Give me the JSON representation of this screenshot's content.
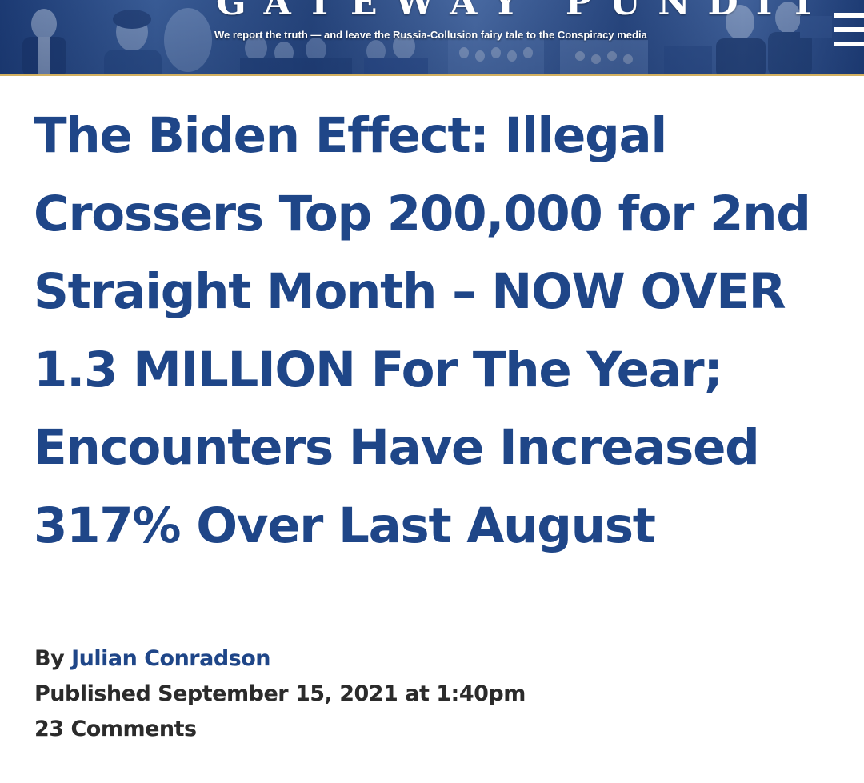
{
  "header": {
    "site_name": "GATEWAY PUNDIT",
    "tagline": "We report the truth — and leave the Russia-Collusion fairy tale to the Conspiracy media",
    "menu_icon": "hamburger-menu-icon",
    "colors": {
      "banner": "#2f5292",
      "rule": "#d2b060"
    }
  },
  "article": {
    "headline": "The Biden Effect: Illegal Crossers Top 200,000 for 2nd Straight Month – NOW OVER 1.3 MILLION For The Year; Encounters Have Increased 317% Over Last August",
    "by_prefix": "By",
    "author": "Julian Conradson",
    "published": "Published September 15, 2021 at 1:40pm",
    "comments": "23 Comments",
    "colors": {
      "headline": "#1f4688",
      "meta": "#2b2b2b"
    }
  }
}
